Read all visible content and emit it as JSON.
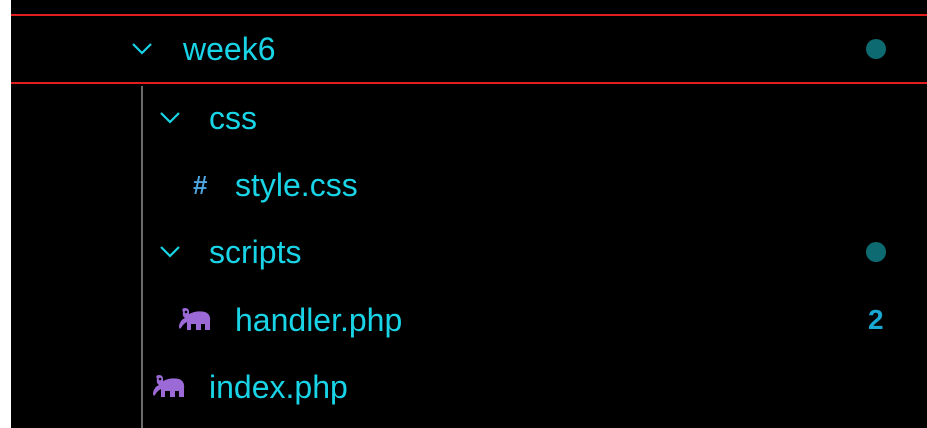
{
  "tree": {
    "folder_root": {
      "label": "week6",
      "expanded": true,
      "modified_dot": true
    },
    "folder_css": {
      "label": "css",
      "expanded": true
    },
    "file_style": {
      "label": "style.css",
      "icon": "hash-icon"
    },
    "folder_scripts": {
      "label": "scripts",
      "expanded": true,
      "modified_dot": true
    },
    "file_handler": {
      "label": "handler.php",
      "icon": "php-elephant-icon",
      "problem_count": "2"
    },
    "file_index": {
      "label": "index.php",
      "icon": "php-elephant-icon"
    }
  },
  "colors": {
    "text": "#19d4e6",
    "dot": "#0e6a71",
    "count": "#19a8d4",
    "focus_border": "#e01e1e",
    "php_icon": "#9b6ad6",
    "hash_icon": "#4ea5e0"
  }
}
